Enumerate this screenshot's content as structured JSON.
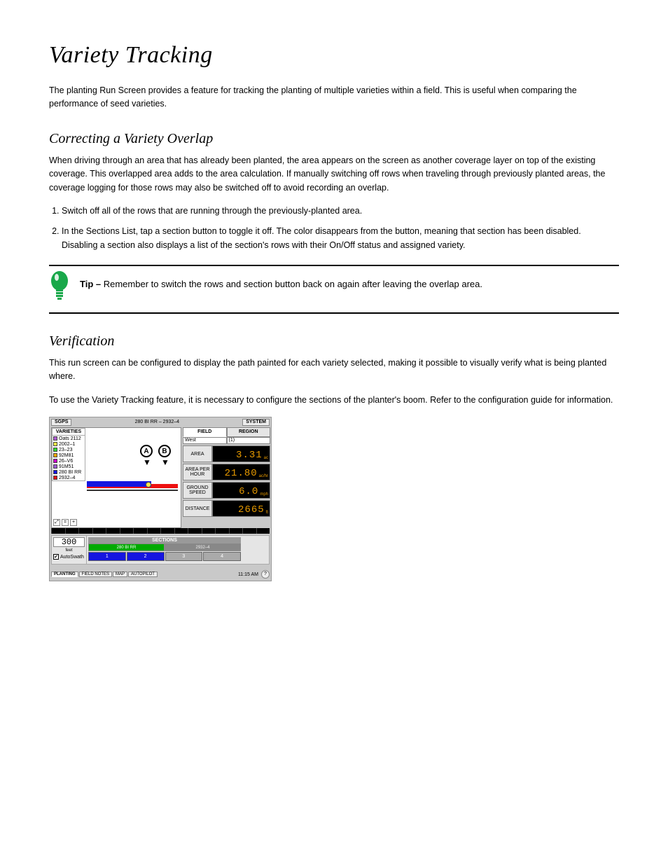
{
  "headings": {
    "h1": "Variety Tracking",
    "h2_correct": "Correcting a Variety Overlap",
    "h2_verify": "Verification"
  },
  "paras": {
    "intro": "The planting Run Screen provides a feature for tracking the planting of multiple varieties within a field. This is useful when comparing the performance of seed varieties.",
    "overlap": "When driving through an area that has already been planted, the area appears on the screen as another coverage layer on top of the existing coverage. This overlapped area adds to the area calculation. If manually switching off rows when traveling through previously planted areas, the coverage logging for those rows may also be switched off to avoid recording an overlap.",
    "verify1": "This run screen can be configured to display the path painted for each variety selected, making it possible to visually verify what is being planted where.",
    "verify2": "To use the Variety Tracking feature, it is necessary to configure the sections of the planter's boom. Refer to the configuration guide for information."
  },
  "steps": [
    "Switch off all of the rows that are running through the previously-planted area.",
    "In the Sections List, tap a section button to toggle it off. The color disappears from the button, meaning that section has been disabled. Disabling a section also displays a list of the section's rows with their On/Off status and assigned variety."
  ],
  "tip": {
    "label_bold": "Tip –",
    "text": "Remember to switch the rows and section button back on again after leaving the overlap area."
  },
  "shot": {
    "topbar": {
      "left": "SGPS",
      "title": "280 BI RR – 2932–4",
      "right": "SYSTEM"
    },
    "varieties": {
      "header": "VARIETIES",
      "items": [
        {
          "label": "Oats 2112",
          "color": "#b05bd4"
        },
        {
          "label": "2002–1",
          "color": "#fff04a"
        },
        {
          "label": "23–23",
          "color": "#2fe02f"
        },
        {
          "label": "92M81",
          "color": "#f0a800"
        },
        {
          "label": "26–V6",
          "color": "#c800c8"
        },
        {
          "label": "91M51",
          "color": "#9b59d0"
        },
        {
          "label": "280 BI RR",
          "color": "#1515e0"
        },
        {
          "label": "2932–4",
          "color": "#e01515"
        }
      ]
    },
    "pins": {
      "a": "A",
      "b": "B"
    },
    "zoom": {
      "out": "⤢",
      "sep": "=",
      "in": "+"
    },
    "field_region": {
      "field": "FIELD",
      "region": "REGION",
      "field_val": "West",
      "region_val": "(1)"
    },
    "gauges": [
      {
        "label": "AREA",
        "value": "3.31",
        "unit": "ac"
      },
      {
        "label": "AREA PER HOUR",
        "value": "21.80",
        "unit": "ac/hr"
      },
      {
        "label": "GROUND SPEED",
        "value": "6.0",
        "unit": "mph"
      },
      {
        "label": "DISTANCE",
        "value": "2665",
        "unit": "ft"
      }
    ],
    "midband": {
      "feet_val": "300",
      "feet_label": "feet",
      "autoswath_label": "AutoSwath",
      "sections_header": "SECTIONS",
      "row1": [
        {
          "label": "280 BI RR",
          "cls": "g"
        },
        {
          "label": "2932–4",
          "cls": "gr"
        }
      ],
      "row2": [
        {
          "label": "1",
          "on": true
        },
        {
          "label": "2",
          "on": true
        },
        {
          "label": "3",
          "on": false
        },
        {
          "label": "4",
          "on": false
        }
      ]
    },
    "bottom": {
      "tabs": [
        "PLANTING",
        "FIELD NOTES",
        "MAP",
        "AUTOPILOT"
      ],
      "active": 0,
      "clock": "11:15 AM",
      "help": "?"
    }
  }
}
